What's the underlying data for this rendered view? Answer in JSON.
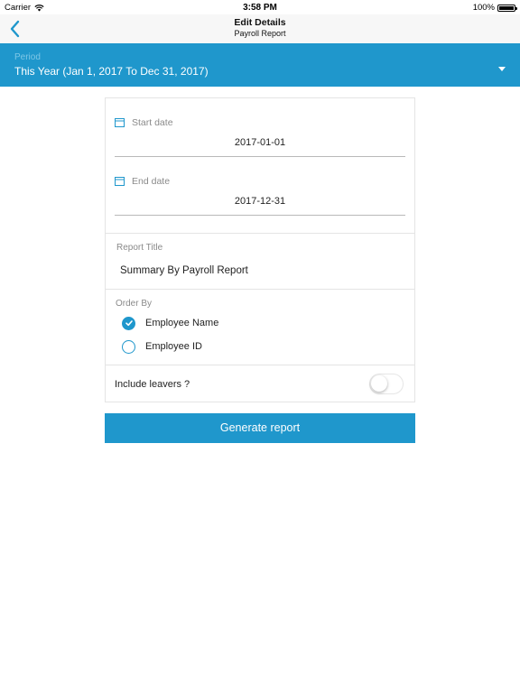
{
  "status_bar": {
    "carrier": "Carrier",
    "time": "3:58 PM",
    "battery": "100%"
  },
  "nav": {
    "title": "Edit Details",
    "subtitle": "Payroll Report"
  },
  "period": {
    "label": "Period",
    "value": "This Year (Jan 1, 2017 To Dec 31, 2017)"
  },
  "dates": {
    "start": {
      "label": "Start date",
      "value": "2017-01-01"
    },
    "end": {
      "label": "End date",
      "value": "2017-12-31"
    }
  },
  "report": {
    "label": "Report Title",
    "value": "Summary By Payroll Report"
  },
  "order_by": {
    "label": "Order By",
    "options": [
      {
        "label": "Employee Name",
        "checked": true
      },
      {
        "label": "Employee ID",
        "checked": false
      }
    ]
  },
  "leavers": {
    "label": "Include leavers ?",
    "on": false
  },
  "generate_label": "Generate report",
  "colors": {
    "accent": "#1f97cc",
    "period_label": "#7fc7e6",
    "muted_text": "#8a8a8a"
  }
}
